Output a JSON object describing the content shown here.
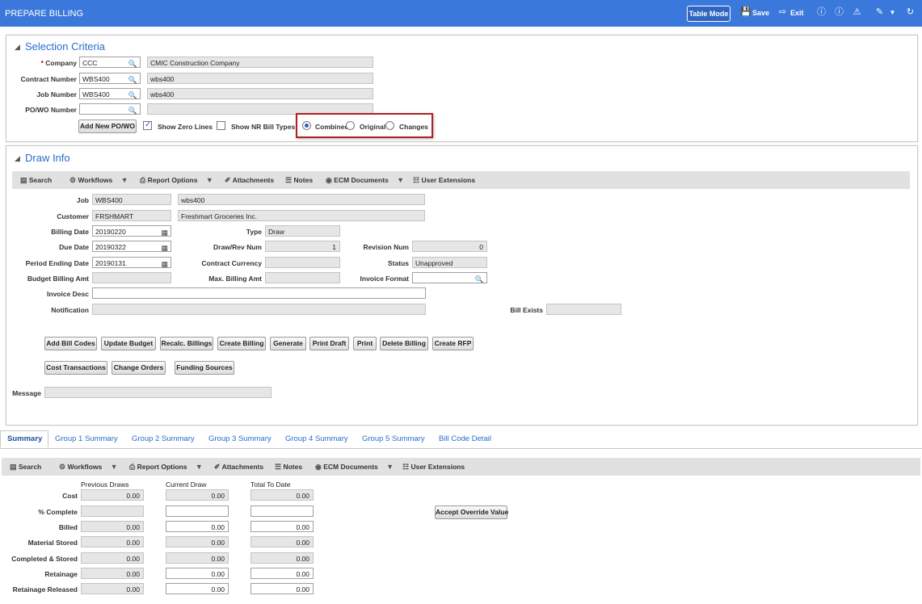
{
  "header": {
    "title": "PREPARE BILLING",
    "table_mode_label": "Table Mode",
    "save_label": "Save",
    "exit_label": "Exit"
  },
  "selection": {
    "title": "Selection Criteria",
    "company_label": "Company",
    "company_value": "CCC",
    "company_desc": "CMIC Construction Company",
    "contract_label": "Contract Number",
    "contract_value": "WBS400",
    "contract_desc": "wbs400",
    "job_label": "Job Number",
    "job_value": "WBS400",
    "job_desc": "wbs400",
    "po_label": "PO/WO Number",
    "po_value": "",
    "po_desc": "",
    "add_po_label": "Add New PO/WO",
    "show_zero_label": "Show Zero Lines",
    "show_zero_checked": true,
    "show_nr_label": "Show NR Bill Types",
    "show_nr_checked": false,
    "radio_combined": "Combined",
    "radio_original": "Original",
    "radio_changes": "Changes",
    "radio_selected": "Combined",
    "highlight_color": "#b11f24"
  },
  "draw": {
    "title": "Draw Info",
    "toolbar": {
      "search": "Search",
      "workflows": "Workflows",
      "report_options": "Report Options",
      "attachments": "Attachments",
      "notes": "Notes",
      "ecm": "ECM Documents",
      "user_ext": "User Extensions"
    },
    "job_label": "Job",
    "job_value": "WBS400",
    "job_desc": "wbs400",
    "customer_label": "Customer",
    "customer_value": "FRSHMART",
    "customer_desc": "Freshmart Groceries Inc.",
    "billing_date_label": "Billing Date",
    "billing_date": "20190220",
    "type_label": "Type",
    "type_value": "Draw",
    "due_date_label": "Due Date",
    "due_date": "20190322",
    "drawrev_label": "Draw/Rev Num",
    "drawrev_value": "1",
    "revision_label": "Revision Num",
    "revision_value": "0",
    "period_label": "Period Ending Date",
    "period_value": "20190131",
    "contract_currency_label": "Contract Currency",
    "contract_currency_value": "",
    "status_label": "Status",
    "status_value": "Unapproved",
    "budget_label": "Budget Billing Amt",
    "budget_value": "",
    "max_label": "Max. Billing Amt",
    "max_value": "",
    "invoice_format_label": "Invoice Format",
    "invoice_format_value": "",
    "invoice_desc_label": "Invoice Desc",
    "invoice_desc_value": "",
    "notification_label": "Notification",
    "notification_value": "",
    "bill_exists_label": "Bill Exists",
    "bill_exists_value": "",
    "buttons1": [
      "Add Bill Codes",
      "Update Budget",
      "Recalc. Billings",
      "Create Billing",
      "Generate",
      "Print Draft",
      "Print",
      "Delete Billing",
      "Create RFP"
    ],
    "buttons2": [
      "Cost Transactions",
      "Change Orders",
      "Funding Sources"
    ],
    "message_label": "Message",
    "message_value": ""
  },
  "tabs": [
    "Summary",
    "Group 1 Summary",
    "Group 2 Summary",
    "Group 3 Summary",
    "Group 4 Summary",
    "Group 5 Summary",
    "Bill Code Detail"
  ],
  "summary": {
    "toolbar": {
      "search": "Search",
      "workflows": "Workflows",
      "report_options": "Report Options",
      "attachments": "Attachments",
      "notes": "Notes",
      "ecm": "ECM Documents",
      "user_ext": "User Extensions"
    },
    "col_previous": "Previous Draws",
    "col_current": "Current Draw",
    "col_total": "Total To Date",
    "accept_override_label": "Accept Override Value",
    "rows": [
      {
        "label": "Cost",
        "previous": "0.00",
        "current": "0.00",
        "total": "0.00"
      },
      {
        "label": "% Complete",
        "previous": "",
        "current": "",
        "total": ""
      },
      {
        "label": "Billed",
        "previous": "0.00",
        "current": "0.00",
        "total": "0.00"
      },
      {
        "label": "Material Stored",
        "previous": "0.00",
        "current": "0.00",
        "total": "0.00"
      },
      {
        "label": "Completed & Stored",
        "previous": "0.00",
        "current": "0.00",
        "total": "0.00"
      },
      {
        "label": "Retainage",
        "previous": "0.00",
        "current": "0.00",
        "total": "0.00"
      },
      {
        "label": "Retainage Released",
        "previous": "0.00",
        "current": "0.00",
        "total": "0.00"
      }
    ]
  }
}
